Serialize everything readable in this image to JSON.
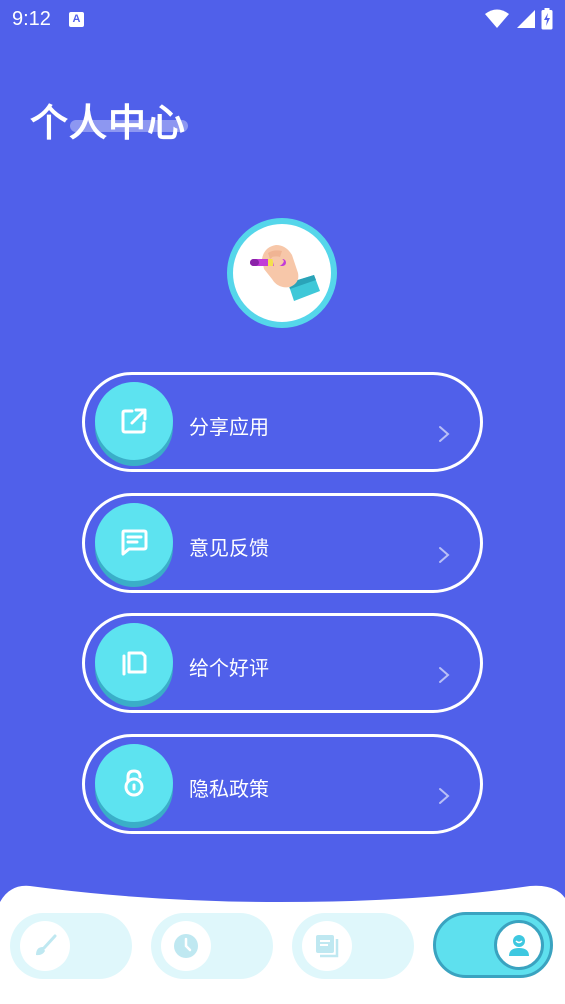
{
  "status_bar": {
    "time": "9:12",
    "notification_icon": "A"
  },
  "header": {
    "title": "个人中心"
  },
  "avatar": {
    "icon": "hand-holding-pen"
  },
  "menu": [
    {
      "label": "分享应用",
      "icon": "share-icon"
    },
    {
      "label": "意见反馈",
      "icon": "feedback-icon"
    },
    {
      "label": "给个好评",
      "icon": "rate-icon"
    },
    {
      "label": "隐私政策",
      "icon": "lock-icon"
    }
  ],
  "bottom_nav": {
    "tabs": [
      {
        "icon": "brush-icon",
        "active": false
      },
      {
        "icon": "clock-icon",
        "active": false
      },
      {
        "icon": "gallery-icon",
        "active": false
      },
      {
        "icon": "profile-icon",
        "active": true
      }
    ]
  },
  "colors": {
    "background": "#5060ea",
    "accent": "#5de3f0",
    "accent_shadow": "#3aaec8"
  }
}
